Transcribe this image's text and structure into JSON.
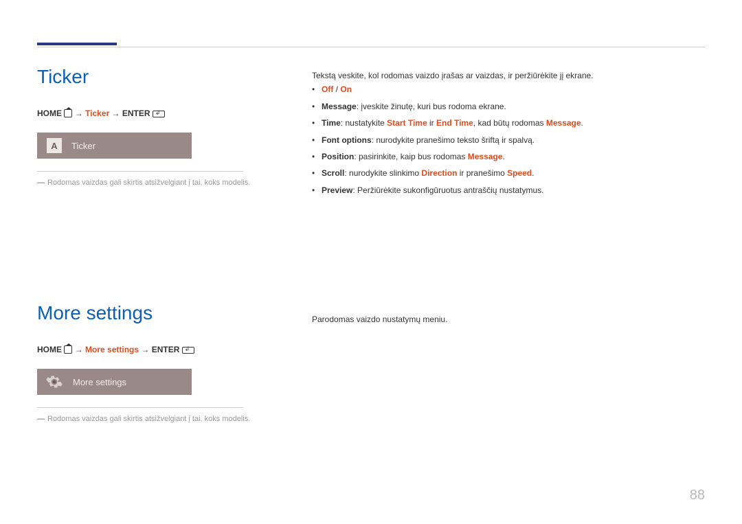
{
  "section1": {
    "title": "Ticker",
    "crumb": {
      "home": "HOME",
      "arrow": "→",
      "mid": "Ticker",
      "enter": "ENTER"
    },
    "tile_icon_text": "A",
    "tile_label": "Ticker",
    "note": "Rodomas vaizdas gali skirtis atsižvelgiant į tai, koks modelis.",
    "right_intro": "Tekstą veskite, kol rodomas vaizdo įrašas ar vaizdas, ir peržiūrėkite jį ekrane.",
    "bullets": {
      "offon1": "Off",
      "offon_sep": " / ",
      "offon2": "On",
      "msg_k": "Message",
      "msg_t": ": įveskite žinutę, kuri bus rodoma ekrane.",
      "time_k": "Time",
      "time_t1": ": nustatykite ",
      "time_st": "Start Time",
      "time_t2": " ir ",
      "time_et": "End Time",
      "time_t3": ", kad būtų rodomas ",
      "time_msg": "Message",
      "time_t4": ".",
      "font_k": "Font options",
      "font_t": ": nurodykite pranešimo teksto šriftą ir spalvą.",
      "pos_k": "Position",
      "pos_t1": ": pasirinkite, kaip bus rodomas ",
      "pos_msg": "Message",
      "pos_t2": ".",
      "scr_k": "Scroll",
      "scr_t1": ": nurodykite slinkimo ",
      "scr_dir": "Direction",
      "scr_t2": " ir pranešimo ",
      "scr_sp": "Speed",
      "scr_t3": ".",
      "prev_k": "Preview",
      "prev_t": ": Peržiūrėkite sukonfigūruotus antraščių nustatymus."
    }
  },
  "section2": {
    "title": "More settings",
    "crumb": {
      "home": "HOME",
      "arrow": "→",
      "mid": "More settings",
      "enter": "ENTER"
    },
    "tile_label": "More settings",
    "note": "Rodomas vaizdas gali skirtis atsižvelgiant į tai, koks modelis.",
    "right_text": "Parodomas vaizdo nustatymų meniu."
  },
  "page_number": "88"
}
